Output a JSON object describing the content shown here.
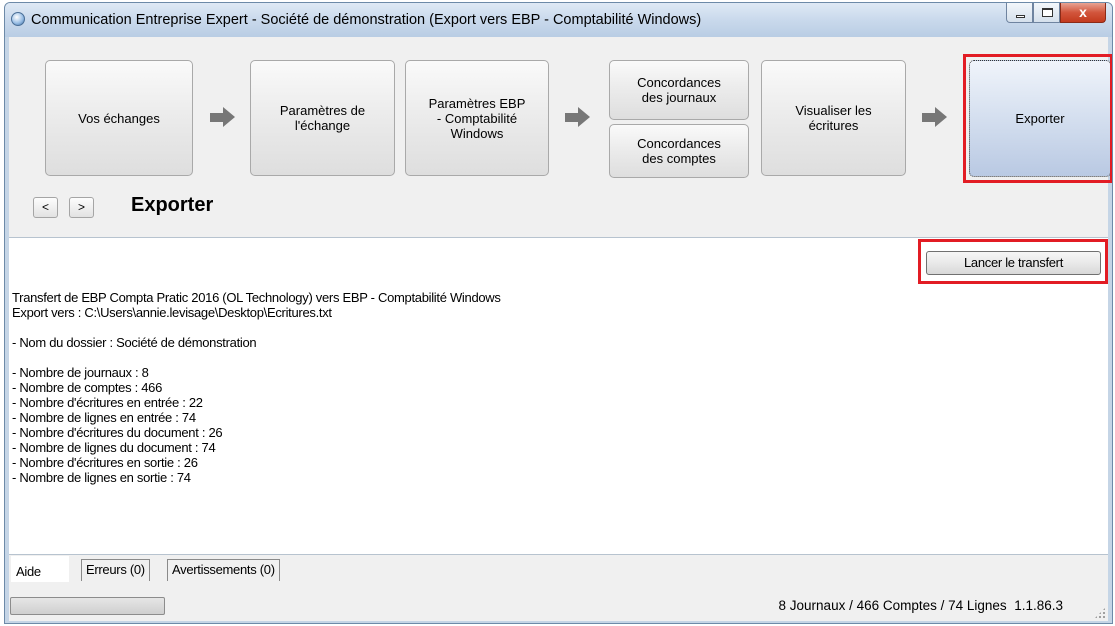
{
  "window": {
    "title": "Communication Entreprise Expert - Société de démonstration (Export vers EBP - Comptabilité Windows)",
    "close_glyph": "x"
  },
  "steps": {
    "vos_echanges": "Vos échanges",
    "parametres_echange": "Paramètres de l'échange",
    "parametres_ebp": "Paramètres EBP - Comptabilité Windows",
    "concordances_journaux": "Concordances des journaux",
    "concordances_comptes": "Concordances des comptes",
    "visualiser": "Visualiser les écritures",
    "exporter": "Exporter"
  },
  "nav": {
    "back_label": "<",
    "forward_label": ">",
    "page_title": "Exporter"
  },
  "panel": {
    "launch_button": "Lancer le transfert",
    "lines": [
      "Transfert de EBP Compta Pratic 2016 (OL Technology) vers EBP - Comptabilité Windows",
      "Export vers : C:\\Users\\annie.levisage\\Desktop\\Ecritures.txt",
      "",
      "- Nom du dossier : Société de démonstration",
      "",
      "- Nombre de journaux : 8",
      "- Nombre de comptes : 466",
      "- Nombre d'écritures en entrée : 22",
      "- Nombre de lignes en entrée : 74",
      "- Nombre d'écritures du document : 26",
      "- Nombre de lignes du document : 74",
      "- Nombre d'écritures en sortie : 26",
      "- Nombre de lignes en sortie : 74"
    ]
  },
  "tabs": {
    "aide": "Aide",
    "erreurs": "Erreurs (0)",
    "avertissements": "Avertissements (0)"
  },
  "status": {
    "summary": "8 Journaux / 466 Comptes / 74 Lignes",
    "version": "1.1.86.3"
  },
  "colors": {
    "highlight": "#e21c24",
    "active_step": "#c4d2e8",
    "arrow": "#777777"
  }
}
